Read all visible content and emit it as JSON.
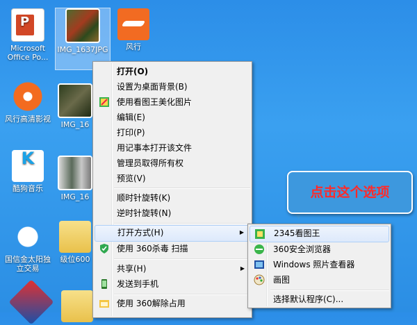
{
  "desktop_icons": [
    {
      "label": "Microsoft Office Po...",
      "icon": "powerpoint-icon"
    },
    {
      "label": "IMG_1637JPG",
      "icon": "photo-icon"
    },
    {
      "label": "风行",
      "icon": "fengxing-icon"
    },
    {
      "label": "风行高清影视",
      "icon": "fengxing-hd-icon"
    },
    {
      "label": "IMG_16",
      "icon": "photo-icon"
    },
    {
      "label": "酷狗音乐",
      "icon": "kugou-icon"
    },
    {
      "label": "IMG_16",
      "icon": "photo-icon"
    },
    {
      "label": "国信金太阳独立交易",
      "icon": "handshake-icon"
    },
    {
      "label": "级位600",
      "icon": "folder-icon"
    }
  ],
  "context_menu": {
    "items": [
      {
        "label": "打开(O)",
        "bold": true
      },
      {
        "label": "设置为桌面背景(B)"
      },
      {
        "label": "使用看图王美化图片",
        "icon": "image-editor-icon"
      },
      {
        "label": "编辑(E)"
      },
      {
        "label": "打印(P)"
      },
      {
        "label": "用记事本打开该文件"
      },
      {
        "label": "管理员取得所有权"
      },
      {
        "label": "预览(V)"
      },
      {
        "label": "顺时针旋转(K)"
      },
      {
        "label": "逆时针旋转(N)"
      },
      {
        "label": "打开方式(H)",
        "has_submenu": true,
        "highlighted": true
      },
      {
        "label": "使用 360杀毒 扫描",
        "icon": "shield-icon"
      },
      {
        "label": "共享(H)",
        "has_submenu": true
      },
      {
        "label": "发送到手机",
        "icon": "phone-icon"
      },
      {
        "label": "使用 360解除占用",
        "icon": "unlock-icon"
      }
    ]
  },
  "open_with_submenu": {
    "items": [
      {
        "label": "2345看图王",
        "icon": "viewer-icon",
        "highlighted": true
      },
      {
        "label": "360安全浏览器",
        "icon": "browser-icon"
      },
      {
        "label": "Windows 照片查看器",
        "icon": "photo-viewer-icon"
      },
      {
        "label": "画图",
        "icon": "paint-icon"
      },
      {
        "label": "选择默认程序(C)..."
      }
    ]
  },
  "callout": {
    "text": "点击这个选项"
  },
  "colors": {
    "desktop": "#2c8ee8",
    "callout_bg": "#3d98de",
    "callout_text": "#ff2a2a"
  }
}
